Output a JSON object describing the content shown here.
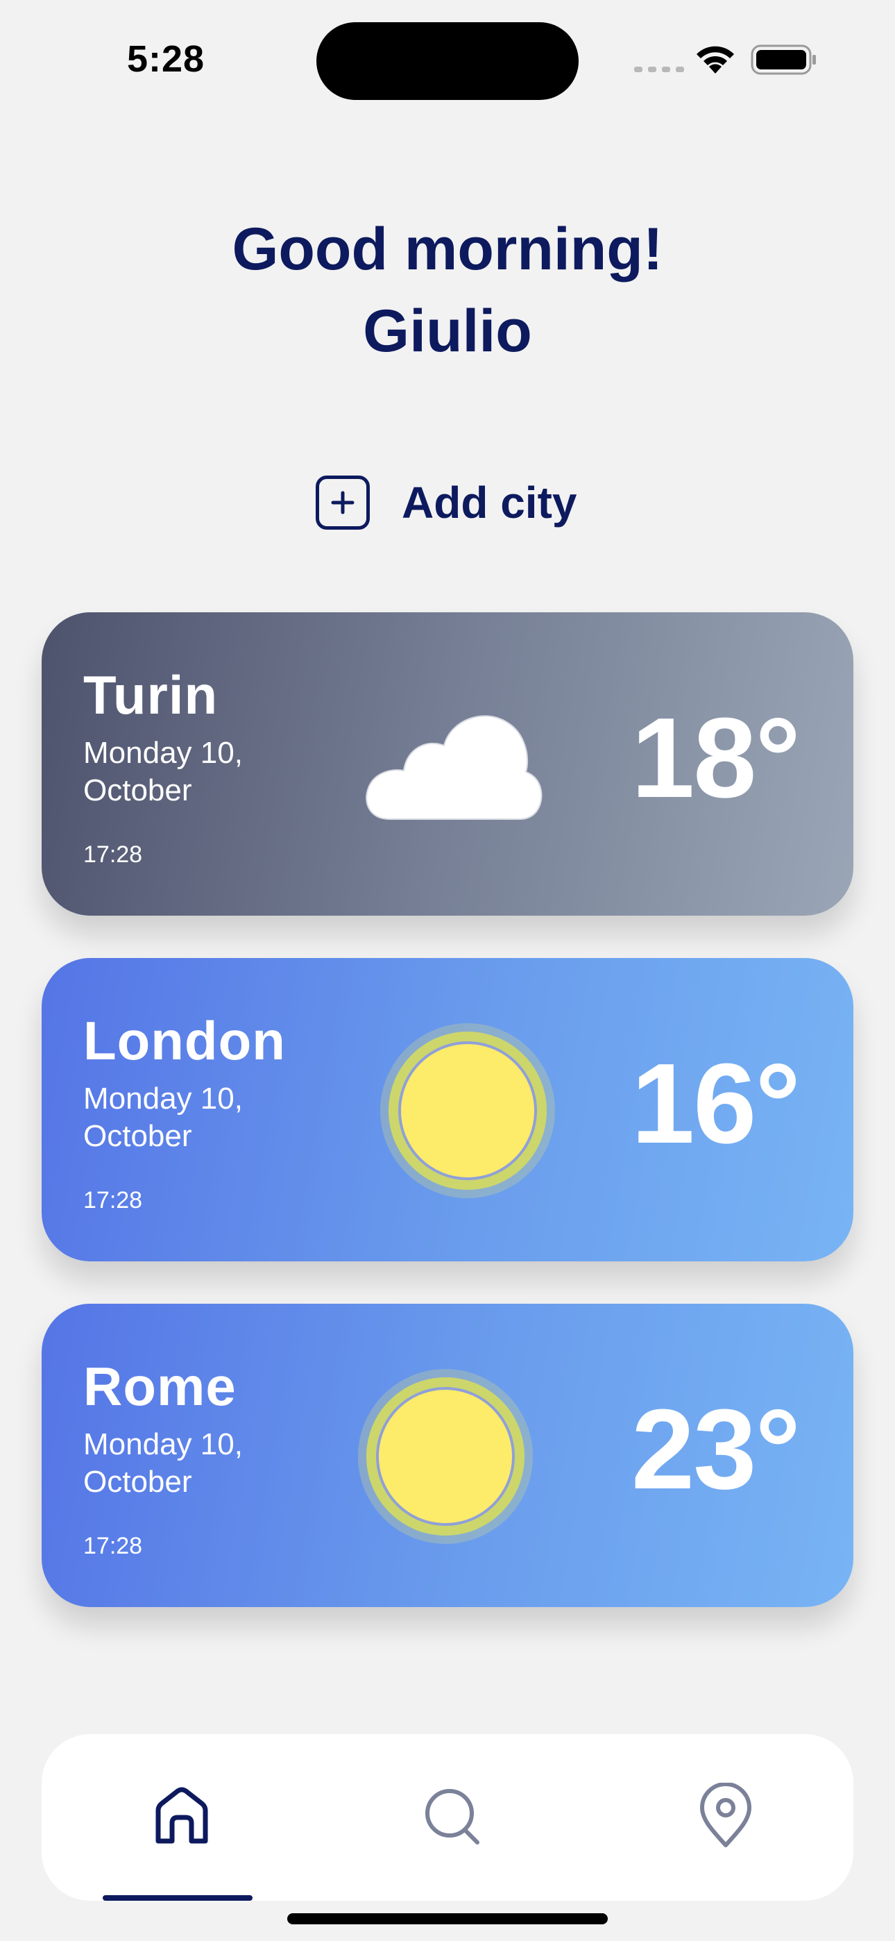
{
  "status_bar": {
    "time": "5:28",
    "icons": [
      "cellular-signal-icon",
      "wifi-icon",
      "battery-icon"
    ]
  },
  "greeting": {
    "line1": "Good morning!",
    "line2": "Giulio"
  },
  "add_city": {
    "label": "Add city",
    "icon": "plus-square-icon"
  },
  "cards": [
    {
      "city": "Turin",
      "date": "Monday 10, October",
      "time": "17:28",
      "temperature": "18°",
      "condition_icon": "cloud-icon"
    },
    {
      "city": "London",
      "date": "Monday 10, October",
      "time": "17:28",
      "temperature": "16°",
      "condition_icon": "sun-icon"
    },
    {
      "city": "Rome",
      "date": "Monday 10, October",
      "time": "17:28",
      "temperature": "23°",
      "condition_icon": "sun-icon"
    }
  ],
  "tab_bar": {
    "tabs": [
      {
        "icon": "home-icon",
        "selected": true
      },
      {
        "icon": "search-icon",
        "selected": false
      },
      {
        "icon": "location-pin-icon",
        "selected": false
      }
    ]
  },
  "colors": {
    "primary": "#0d1a5e",
    "background": "#f2f2f2",
    "cloudy_card_start": "#4e536d",
    "cloudy_card_end": "#9aa6b6",
    "sunny_card_start": "#5575e6",
    "sunny_card_end": "#78b4f4",
    "sun": "#fdeb6a",
    "tab_inactive": "#7b8198"
  }
}
